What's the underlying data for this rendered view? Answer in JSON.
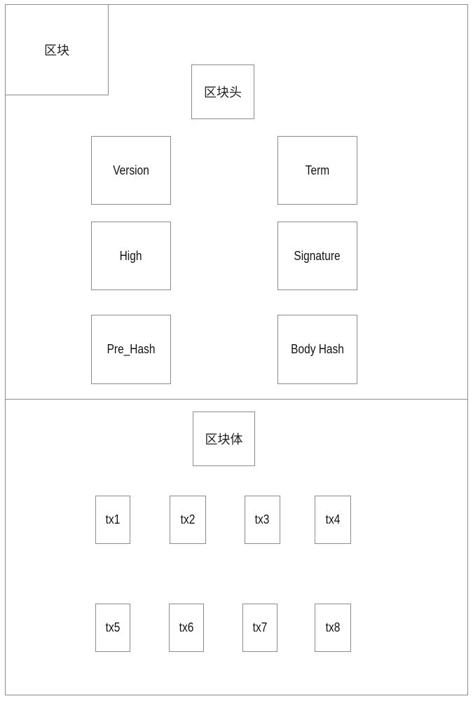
{
  "diagram": {
    "block_label": "区块",
    "header": {
      "title": "区块头",
      "fields_left": [
        "Version",
        "High",
        "Pre_Hash"
      ],
      "fields_right": [
        "Term",
        "Signature",
        "Body Hash"
      ]
    },
    "body": {
      "title": "区块体",
      "transactions_row1": [
        "tx1",
        "tx2",
        "tx3",
        "tx4"
      ],
      "transactions_row2": [
        "tx5",
        "tx6",
        "tx7",
        "tx8"
      ]
    },
    "colors": {
      "border": "#8c8c8c",
      "background": "#ffffff",
      "text": "#111111"
    }
  }
}
